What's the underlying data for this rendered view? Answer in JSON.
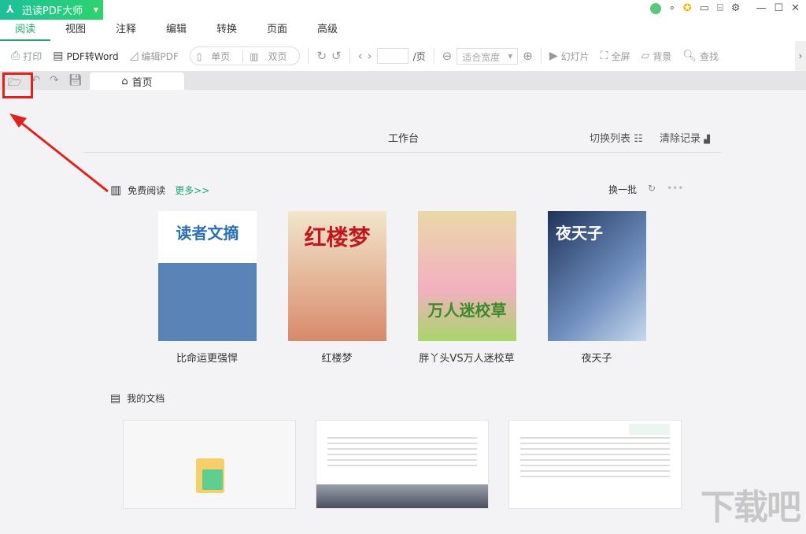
{
  "app": {
    "title": "迅读PDF大师",
    "logo": "pdf-logo"
  },
  "window": {
    "icons": [
      "user-avatar-icon",
      "dot-icon",
      "vip-badge-icon",
      "feedback-icon",
      "skin-icon",
      "settings-icon",
      "minimize-icon",
      "maximize-icon",
      "close-icon"
    ]
  },
  "menu": [
    "阅读",
    "视图",
    "注释",
    "编辑",
    "转换",
    "页面",
    "高级"
  ],
  "toolbar": {
    "print": "打印",
    "pdf2word": "PDF转Word",
    "editpdf": "编辑PDF",
    "single": "单页",
    "double": "双页",
    "page_value": "",
    "page_suffix": "/页",
    "zoom": "适合宽度",
    "slideshow": "幻灯片",
    "fullscreen": "全屏",
    "background": "背景",
    "find": "查找"
  },
  "tab": {
    "home": "首页"
  },
  "workbench": {
    "title": "工作台",
    "switch_list": "切换列表",
    "clear_history": "清除记录"
  },
  "free_reading": {
    "title": "免费阅读",
    "more": "更多>>",
    "refresh": "换一批",
    "books": [
      {
        "title": "比命运更强悍",
        "cover": "读者文摘",
        "color": "#5a84b8"
      },
      {
        "title": "红楼梦",
        "cover": "红楼梦",
        "color": "#e8d4b0"
      },
      {
        "title": "胖丫头VS万人迷校草",
        "cover": "万人迷校草",
        "color": "#a8d66a"
      },
      {
        "title": "夜天子",
        "cover": "夜天子",
        "color": "#4a6a9a"
      }
    ]
  },
  "my_docs": {
    "title": "我的文档"
  },
  "watermark": "下载吧",
  "colors": {
    "accent": "#1ea86b",
    "annotation": "#e2211c"
  }
}
